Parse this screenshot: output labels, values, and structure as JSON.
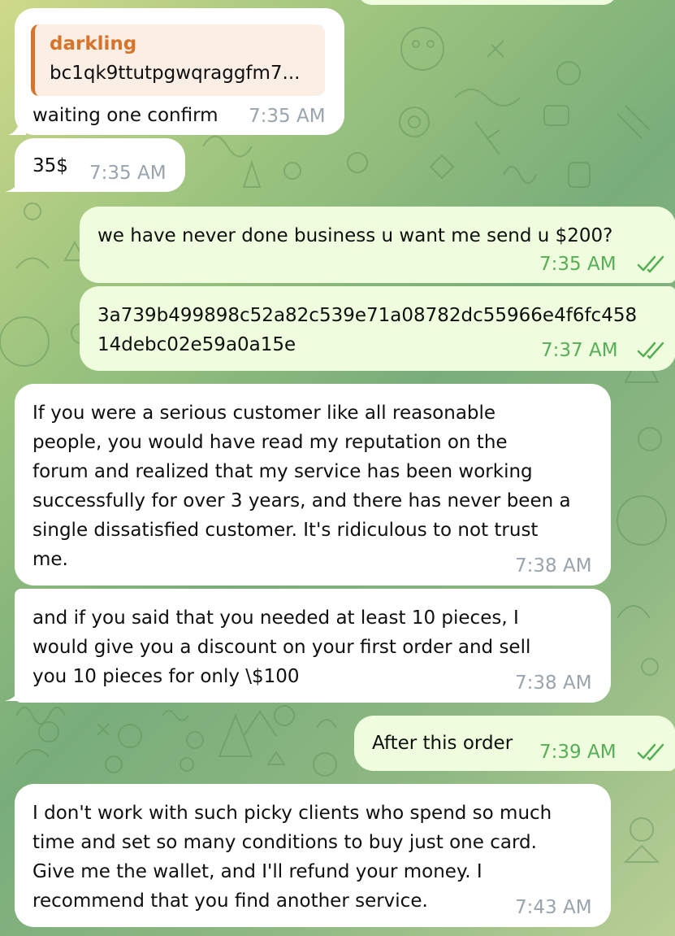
{
  "messages": [
    {
      "id": "m1",
      "direction": "incoming",
      "reply_name": "darkling",
      "reply_text": "bc1qk9ttutpgwqraggfm7...",
      "text": "waiting one confirm",
      "time": "7:35 AM"
    },
    {
      "id": "m2",
      "direction": "incoming",
      "text": "35$",
      "time": "7:35 AM"
    },
    {
      "id": "m3",
      "direction": "outgoing",
      "text": "we have never done business u want me send u $200?",
      "time": "7:35 AM",
      "status": "read"
    },
    {
      "id": "m4",
      "direction": "outgoing",
      "lines": [
        "3a739b499898c52a82c539e71a08782dc55966e4f6fc458",
        "14debc02e59a0a15e"
      ],
      "time": "7:37 AM",
      "status": "read"
    },
    {
      "id": "m5",
      "direction": "incoming",
      "lines": [
        "If you were a serious customer like all reasonable",
        "people, you would have read my reputation on the",
        "forum and realized that my service has been working",
        "successfully for over 3 years, and there has never been a",
        "single dissatisfied customer. It's ridiculous to not trust",
        "me."
      ],
      "time": "7:38 AM"
    },
    {
      "id": "m6",
      "direction": "incoming",
      "lines": [
        "and if you said that you needed at least 10 pieces, I",
        "would give you a discount on your first order and sell",
        "you 10 pieces for only \\$100"
      ],
      "time": "7:38 AM"
    },
    {
      "id": "m7",
      "direction": "outgoing",
      "text": "After this order",
      "time": "7:39 AM",
      "status": "read"
    },
    {
      "id": "m8",
      "direction": "incoming",
      "lines": [
        "I don't work with such picky clients who spend so much",
        "time and set so many conditions to buy just one card.",
        "Give me the wallet, and I'll refund your money. I",
        "recommend that you find another service."
      ],
      "time": "7:43 AM"
    }
  ],
  "colors": {
    "incoming_bg": "#ffffff",
    "outgoing_bg": "#effdde",
    "outgoing_time": "#56ae55",
    "incoming_time": "#9aa4ad",
    "reply_accent": "#d6742b"
  }
}
